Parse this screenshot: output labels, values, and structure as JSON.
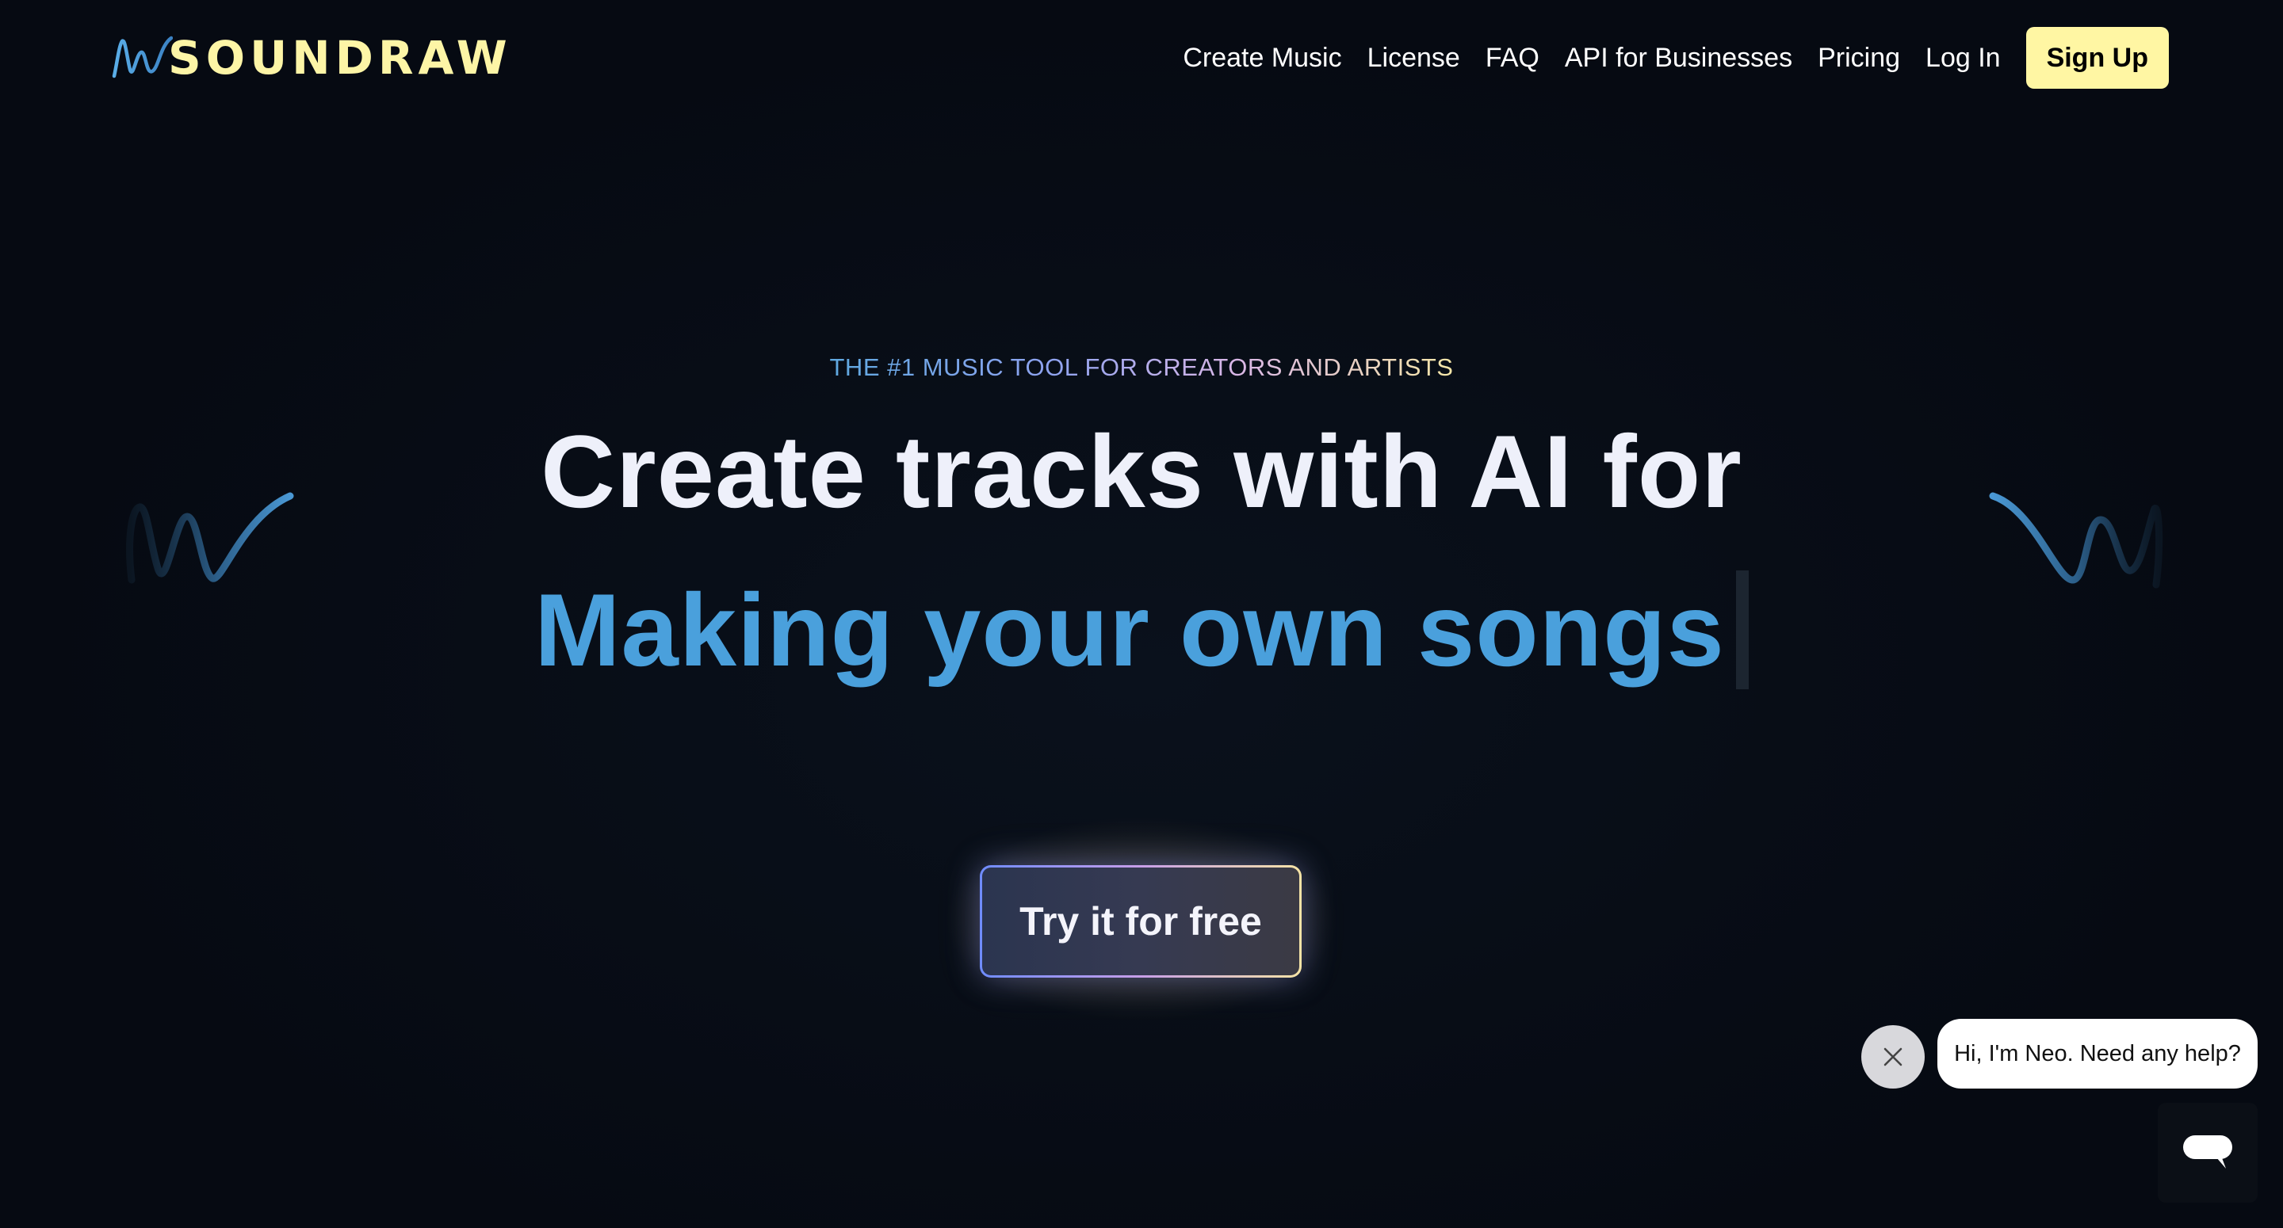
{
  "brand": {
    "name": "SOUNDRAW",
    "logo_icon": "waveform-logo-icon",
    "accent": "#fdf5a6",
    "primary_blue": "#4aa0dc",
    "background": "#070c14"
  },
  "nav": {
    "items": [
      {
        "label": "Create Music"
      },
      {
        "label": "License"
      },
      {
        "label": "FAQ"
      },
      {
        "label": "API for Businesses"
      },
      {
        "label": "Pricing"
      },
      {
        "label": "Log In"
      }
    ],
    "signup_label": "Sign Up"
  },
  "hero": {
    "eyebrow": "THE #1 MUSIC TOOL FOR CREATORS AND ARTISTS",
    "headline": "Create tracks with AI for",
    "subline": "Making your own songs",
    "cta_label": "Try it for free"
  },
  "chat": {
    "message": "Hi, I'm Neo. Need any help?",
    "close_icon": "close-icon",
    "launcher_icon": "chat-icon"
  }
}
